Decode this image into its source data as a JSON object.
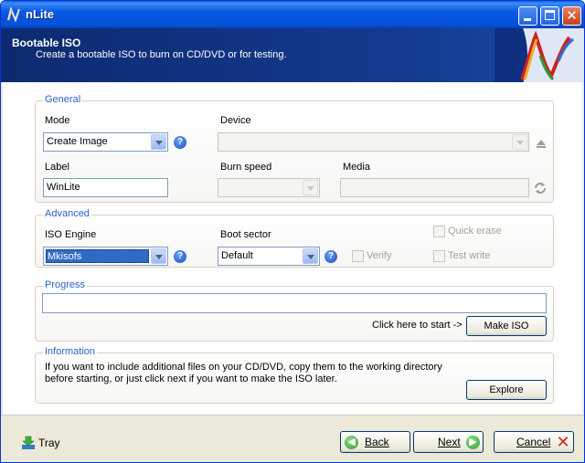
{
  "window": {
    "title": "nLite",
    "logo_glyph": "N"
  },
  "header": {
    "title": "Bootable ISO",
    "subtitle": "Create a bootable ISO to burn on CD/DVD or for testing."
  },
  "general": {
    "legend": "General",
    "mode_label": "Mode",
    "mode_value": "Create Image",
    "device_label": "Device",
    "device_value": "",
    "label_label": "Label",
    "label_value": "WinLite",
    "burn_speed_label": "Burn speed",
    "burn_speed_value": "",
    "media_label": "Media",
    "media_value": ""
  },
  "advanced": {
    "legend": "Advanced",
    "iso_engine_label": "ISO Engine",
    "iso_engine_value": "Mkisofs",
    "boot_sector_label": "Boot sector",
    "boot_sector_value": "Default",
    "quick_erase_label": "Quick erase",
    "verify_label": "Verify",
    "test_write_label": "Test write"
  },
  "progress": {
    "legend": "Progress",
    "hint": "Click here to start ->",
    "make_iso_label": "Make ISO",
    "value": 0
  },
  "information": {
    "legend": "Information",
    "text": "If you want to include additional files on your CD/DVD, copy them to the working directory before starting, or just click next if you want to make the ISO later.",
    "explore_label": "Explore"
  },
  "footer": {
    "tray_label": "Tray",
    "back_label": "Back",
    "next_label": "Next",
    "cancel_label": "Cancel"
  },
  "colors": {
    "titlebar": "#0757e4",
    "header_bg": "#0c2a70",
    "legend_text": "#2a62c8",
    "selection": "#316ac5"
  },
  "icons": {
    "help": "help-icon",
    "device_eject": "eject-icon",
    "media_refresh": "refresh-icon",
    "tray": "tray-download-icon",
    "back": "back-arrow-icon",
    "next": "next-arrow-icon",
    "cancel": "cancel-x-icon"
  }
}
